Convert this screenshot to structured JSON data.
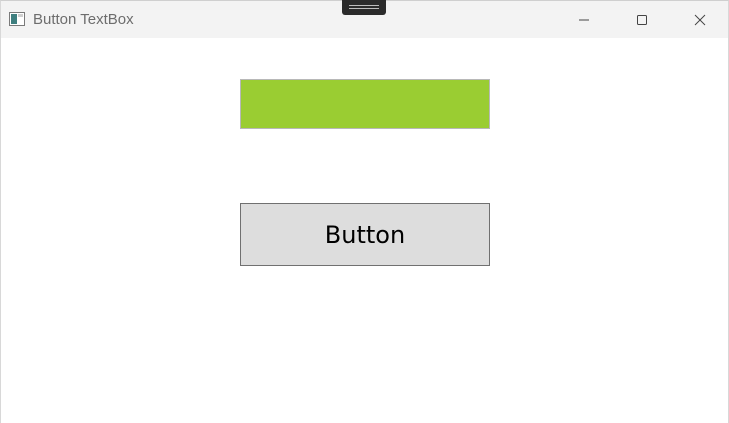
{
  "window": {
    "title": "Button TextBox",
    "app_icon": "window-app-icon",
    "caption_buttons": {
      "minimize_icon": "minimize-icon",
      "maximize_icon": "maximize-icon",
      "close_icon": "close-icon"
    }
  },
  "content": {
    "textbox": {
      "value": "",
      "background_color": "#9acd32"
    },
    "button": {
      "label": "Button",
      "background_color": "#dddddd"
    }
  }
}
